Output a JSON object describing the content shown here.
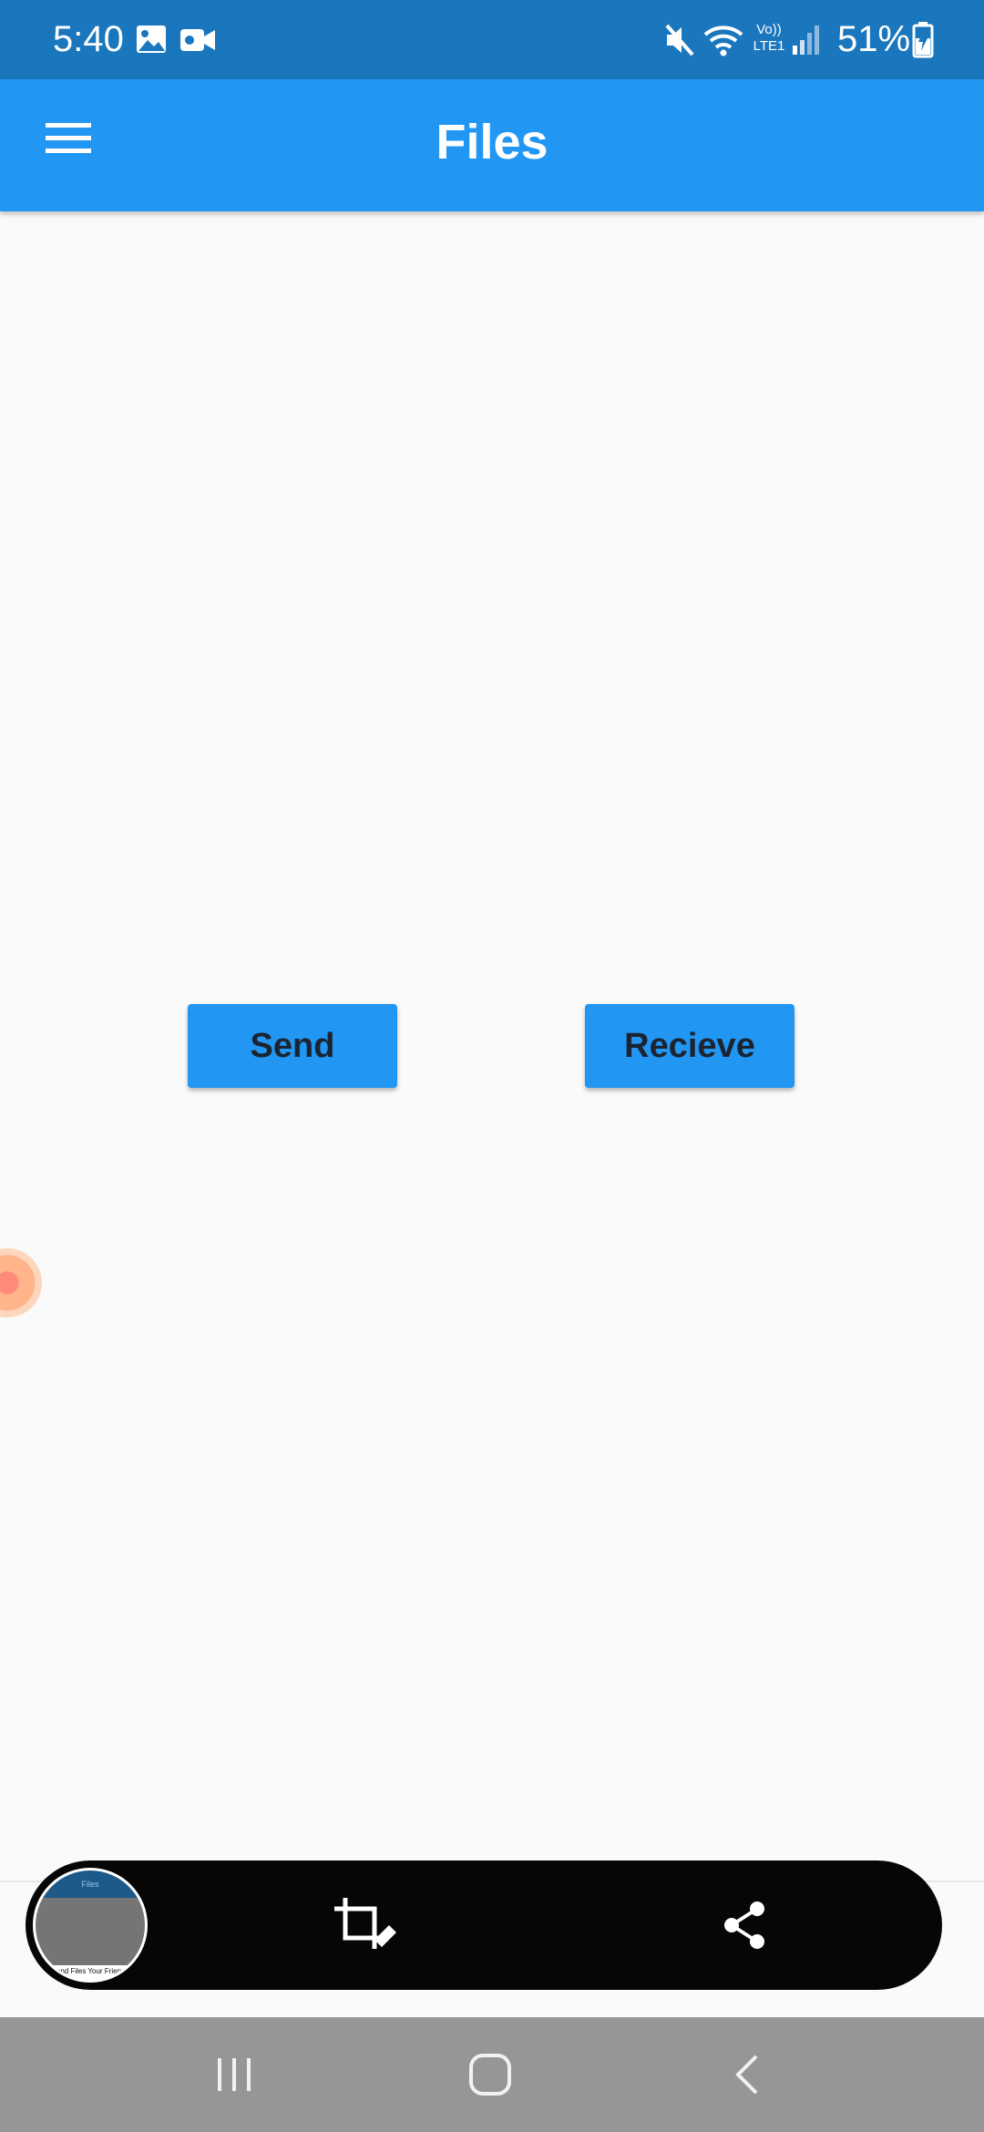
{
  "status_bar": {
    "time": "5:40",
    "battery_percent": "51%",
    "network_label_top": "Vo))",
    "network_label_bottom": "LTE1",
    "icons": [
      "gallery-icon",
      "video-camera-icon",
      "mute-icon",
      "wifi-icon",
      "signal-icon",
      "battery-charging-icon"
    ]
  },
  "app_bar": {
    "title": "Files",
    "menu_icon": "hamburger-menu-icon",
    "color": "#2196f3"
  },
  "main": {
    "send_label": "Send",
    "receive_label": "Recieve",
    "button_color": "#2196f3"
  },
  "screenshot_toolbar": {
    "thumbnail_title": "Files",
    "thumbnail_caption": "Send Files Your Friends",
    "icons": [
      "crop-edit-icon",
      "share-icon"
    ]
  },
  "nav_bar": {
    "icons": [
      "recents-icon",
      "home-icon",
      "back-icon"
    ]
  }
}
